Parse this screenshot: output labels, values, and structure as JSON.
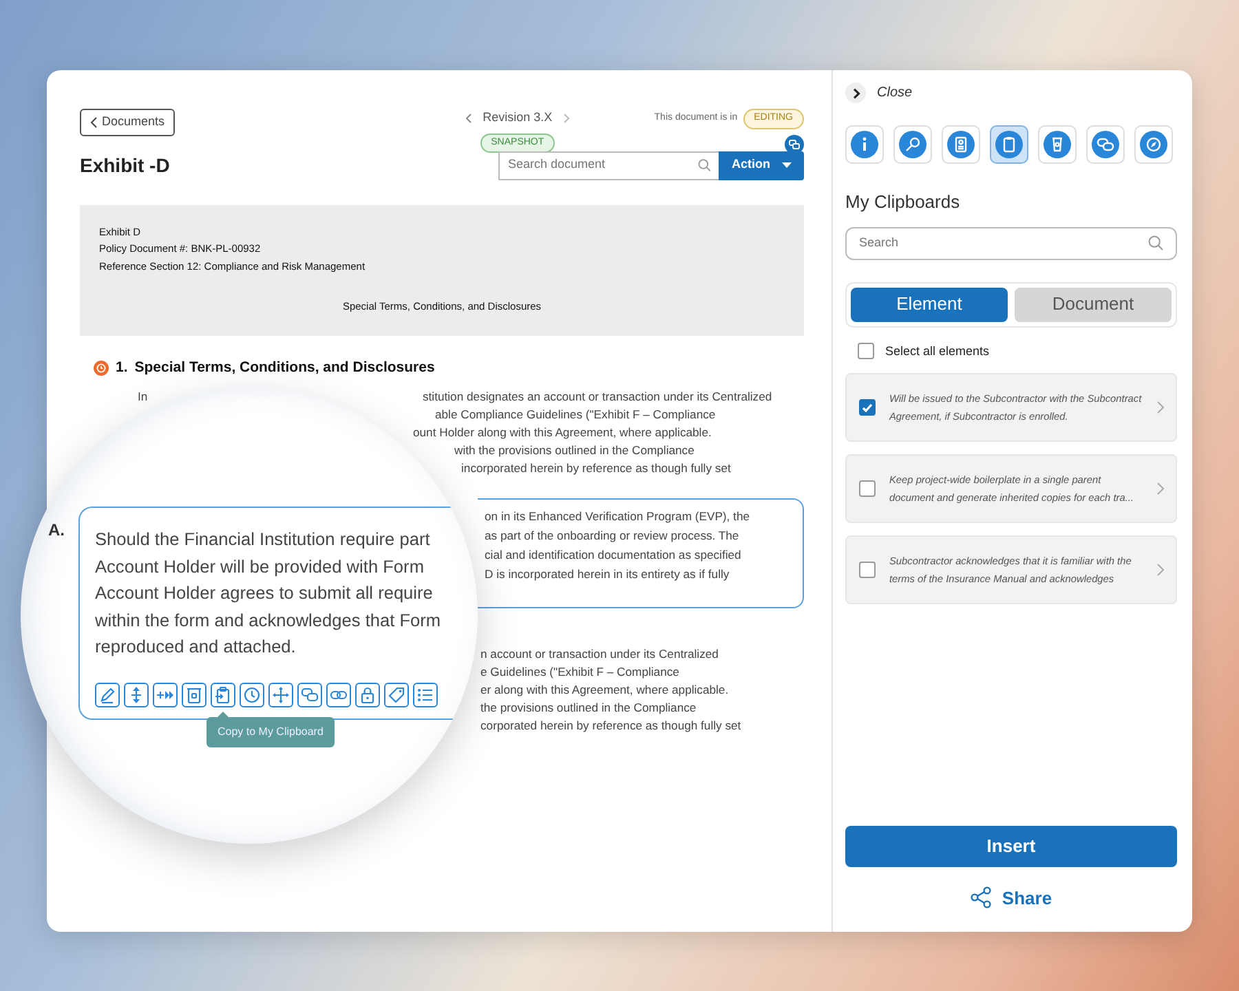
{
  "header": {
    "back": "Documents",
    "revision": "Revision 3.X",
    "revision_badge": "SNAPSHOT",
    "status_label": "This document is in",
    "status_badge": "EDITING",
    "title": "Exhibit -D",
    "search": {
      "placeholder": "Search document"
    },
    "action": "Action"
  },
  "document": {
    "banner": {
      "lines": [
        "Exhibit D",
        "Policy Document #: BNK-PL-00932",
        "Reference Section 12: Compliance and Risk Management"
      ],
      "heading": "Special Terms, Conditions, and Disclosures"
    },
    "section": {
      "number": "1.",
      "title": "Special Terms, Conditions, and Disclosures"
    },
    "paragraphs": [
      {
        "kind": "plain",
        "lead": "In",
        "lines": [
          "stitution designates an account or transaction under its Centralized",
          "able Compliance Guidelines (\"Exhibit F – Compliance",
          "ount Holder along with this Agreement, where applicable.",
          "with the provisions outlined in the Compliance",
          "incorporated herein by reference as though fully set"
        ]
      },
      {
        "kind": "highlighted",
        "lines": [
          "on in its Enhanced Verification Program (EVP), the",
          "as part of the onboarding or review process. The",
          "cial and identification documentation as specified",
          "D is incorporated herein in its entirety as if fully"
        ]
      },
      {
        "kind": "plain",
        "lines": [
          "n account or transaction under its Centralized",
          "e Guidelines (\"Exhibit F – Compliance",
          "er along with this Agreement, where applicable.",
          "the provisions outlined in the Compliance",
          "corporated herein by reference as though fully set"
        ]
      }
    ]
  },
  "magnifier": {
    "label": "A.",
    "lines": [
      "Should the Financial Institution require part",
      "Account Holder will be provided with Form",
      "Account Holder agrees to submit all require",
      "within the form and acknowledges that Form",
      "reproduced and attached."
    ],
    "tooltip": "Copy to My Clipboard"
  },
  "panel": {
    "close": "Close",
    "tools": [
      {
        "selected": false
      },
      {
        "selected": false
      },
      {
        "selected": false
      },
      {
        "selected": true
      },
      {
        "selected": false
      },
      {
        "selected": false
      },
      {
        "selected": false
      }
    ],
    "title": "My Clipboards",
    "search": {
      "placeholder": "Search"
    },
    "segments": [
      {
        "label": "Element",
        "selected": true
      },
      {
        "label": "Document",
        "selected": false
      }
    ],
    "select_all": {
      "label": "Select all elements",
      "checked": false
    },
    "items": [
      {
        "text": "Will be issued to the Subcontractor with the Subcontract Agreement, if Subcontractor is enrolled.",
        "checked": true
      },
      {
        "text": "Keep project-wide boilerplate in a single parent document and generate inherited copies for each tra...",
        "checked": false
      },
      {
        "text": "Subcontractor acknowledges that it is familiar with the terms of the Insurance Manual and acknowledges",
        "checked": false
      }
    ],
    "insert": "Insert",
    "share": "Share"
  }
}
